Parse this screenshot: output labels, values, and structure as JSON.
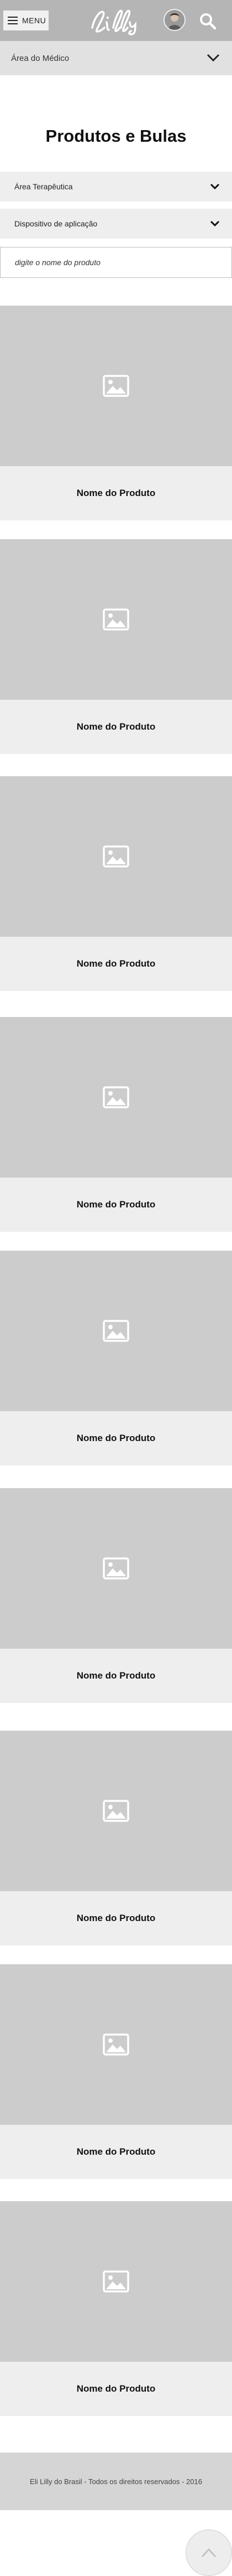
{
  "header": {
    "menu_label": "MENU",
    "brand_logo": "Lilly"
  },
  "area_selector": {
    "label": "Área do Médico"
  },
  "page": {
    "title": "Produtos e Bulas"
  },
  "filters": [
    {
      "label": "Área Terapêutica"
    },
    {
      "label": "Dispositivo de aplicação"
    }
  ],
  "search": {
    "placeholder": "digite o nome do produto"
  },
  "products": [
    {
      "name": "Nome do Produto",
      "image_icon": "image-placeholder-icon"
    },
    {
      "name": "Nome do Produto",
      "image_icon": "image-placeholder-icon"
    },
    {
      "name": "Nome do Produto",
      "image_icon": "image-placeholder-icon"
    },
    {
      "name": "Nome do Produto",
      "image_icon": "image-placeholder-icon"
    },
    {
      "name": "Nome do Produto",
      "image_icon": "image-placeholder-icon"
    },
    {
      "name": "Nome do Produto",
      "image_icon": "image-placeholder-icon"
    },
    {
      "name": "Nome do Produto",
      "image_icon": "image-placeholder-icon"
    },
    {
      "name": "Nome do Produto",
      "image_icon": "image-placeholder-icon"
    },
    {
      "name": "Nome do Produto",
      "image_icon": "image-placeholder-icon"
    }
  ],
  "footer": {
    "copyright": "Eli Lilly do Brasil - Todos os direitos reservados - 2016"
  },
  "colors": {
    "header_bg": "#b5b5b5",
    "area_bar_bg": "#e1e1e1",
    "filter_bg": "#eeeeee",
    "image_placeholder_bg": "#cccccc",
    "footer_bg": "#d5d5d5"
  }
}
